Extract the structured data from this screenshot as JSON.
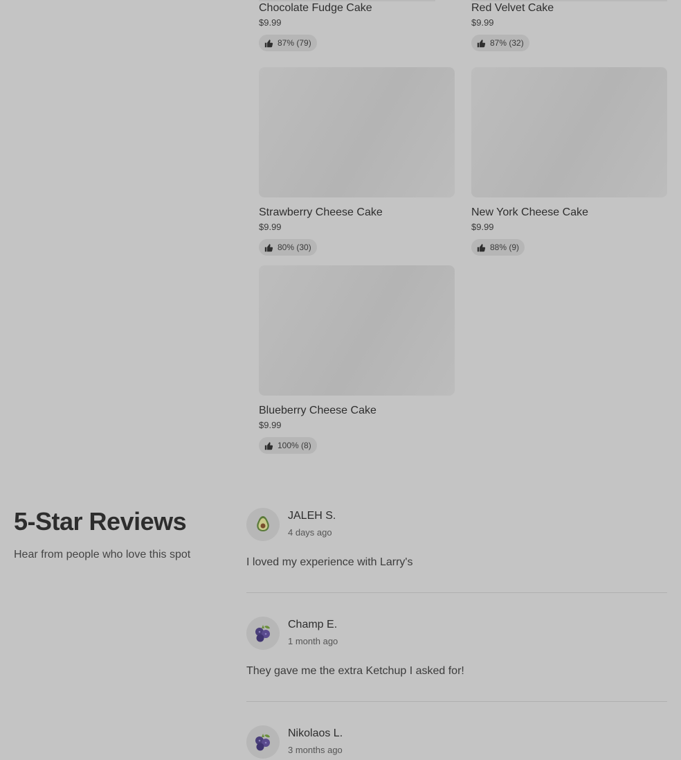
{
  "menu_items": [
    {
      "name": "Chocolate Fudge Cake",
      "price": "$9.99",
      "rating": "87% (79)"
    },
    {
      "name": "Red Velvet Cake",
      "price": "$9.99",
      "rating": "87% (32)"
    },
    {
      "name": "Strawberry Cheese Cake",
      "price": "$9.99",
      "rating": "80% (30)"
    },
    {
      "name": "New York Cheese Cake",
      "price": "$9.99",
      "rating": "88% (9)"
    },
    {
      "name": "Blueberry Cheese Cake",
      "price": "$9.99",
      "rating": "100% (8)"
    }
  ],
  "reviews_section": {
    "title": "5-Star Reviews",
    "subtitle": "Hear from people who love this spot"
  },
  "reviews": [
    {
      "author": "JALEH S.",
      "time": "4 days ago",
      "text": "I loved my experience with Larry's",
      "avatar_icon": "avocado-icon"
    },
    {
      "author": "Champ E.",
      "time": "1 month ago",
      "text": "They gave me the extra Ketchup I asked for!",
      "avatar_icon": "blueberry-icon"
    },
    {
      "author": "Nikolaos L.",
      "time": "3 months ago",
      "text": "",
      "avatar_icon": "blueberry-icon"
    }
  ],
  "icons": {
    "rating": "thumbs-up-icon"
  },
  "colors": {
    "background": "#c4c4c4",
    "card_image": "#b8b8b8",
    "rating_pill": "#b6b6b6"
  }
}
